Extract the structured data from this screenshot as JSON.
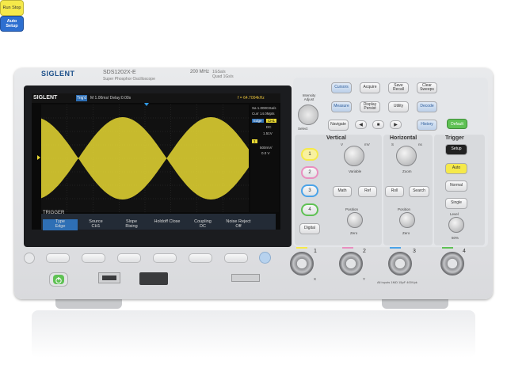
{
  "header": {
    "brand": "SIGLENT",
    "model": "SDS1202X-E",
    "subtitle": "Super Phosphor Oscilloscope",
    "bandwidth": "200 MHz",
    "spec_line1": "1GSa/s",
    "spec_line2": "Quad 1Gs/s"
  },
  "screen": {
    "logo": "SIGLENT",
    "badge": "Trig'd",
    "timebase": "M 1.00ms/ Delay:0.00s",
    "freq": "f = 64.7004kHz",
    "side": {
      "sa": "Sa 1.000GSa/s",
      "curr": "Curr 14.0Mpts",
      "edge": "Edge",
      "ch": "CH1",
      "dc": "DC",
      "level": "1.51V",
      "ch1_label": "1",
      "ch1_val": "500mV/",
      "offset": "0.0 V"
    },
    "trigger_title": "TRIGGER",
    "menu": [
      {
        "top": "Type",
        "bottom": "Edge"
      },
      {
        "top": "Source",
        "bottom": "CH1"
      },
      {
        "top": "Slope",
        "bottom": "Rising"
      },
      {
        "top": "Holdoff Close",
        "bottom": ""
      },
      {
        "top": "Coupling",
        "bottom": "DC"
      },
      {
        "top": "Noise Reject",
        "bottom": "Off"
      }
    ]
  },
  "panel": {
    "intensity": "Intensity Adjust",
    "select": "Select",
    "buttons": {
      "cursors": "Cursors",
      "acquire": "Acquire",
      "save_recall": "Save Recall",
      "clear_sweeps": "Clear Sweeps",
      "measure": "Measure",
      "display_persist": "Display Persist",
      "utility": "Utility",
      "decode": "Decode",
      "navigate": "Navigate",
      "history": "History",
      "run_stop": "Run Stop",
      "auto_setup": "Auto Setup",
      "default": "Default",
      "math": "Math",
      "ref": "Ref",
      "roll": "Roll",
      "search": "Search",
      "digital": "Digital",
      "setup": "Setup",
      "auto": "Auto",
      "normal": "Normal",
      "single": "Single"
    },
    "sections": {
      "vertical": "Vertical",
      "horizontal": "Horizontal",
      "trigger": "Trigger"
    },
    "labels": {
      "variable": "Variable",
      "zoom": "Zoom",
      "position": "Position",
      "zero": "Zero",
      "level": "Level",
      "fifty": "50%",
      "v": "V",
      "mv": "mV",
      "s": "S",
      "ns": "ns"
    },
    "channels": [
      "1",
      "2",
      "3",
      "4"
    ]
  },
  "inputs": {
    "channels": [
      "1",
      "2",
      "3",
      "4"
    ],
    "x": "X",
    "y": "Y",
    "warning": "All inputs 1MΩ 15pF 400Vpk"
  },
  "colors": {
    "ch1": "#f5e94a",
    "ch2": "#e98fbf",
    "ch3": "#4aa3e8",
    "ch4": "#5fc154",
    "trace": "#e8d833"
  }
}
